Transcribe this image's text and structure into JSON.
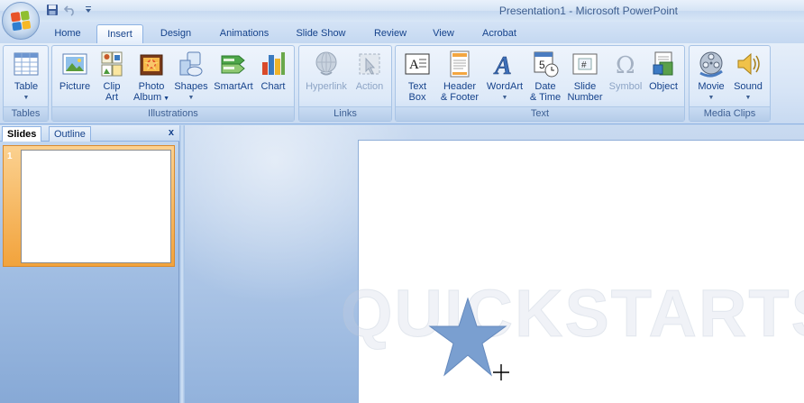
{
  "window": {
    "title": "Presentation1 - Microsoft PowerPoint"
  },
  "quick_access": {
    "save_icon": "save-icon",
    "undo_icon": "undo-icon",
    "customize_icon": "customize-qat-icon"
  },
  "tabs": [
    {
      "label": "Home"
    },
    {
      "label": "Insert"
    },
    {
      "label": "Design"
    },
    {
      "label": "Animations"
    },
    {
      "label": "Slide Show"
    },
    {
      "label": "Review"
    },
    {
      "label": "View"
    },
    {
      "label": "Acrobat"
    }
  ],
  "active_tab": "Insert",
  "ribbon": {
    "groups": {
      "tables": {
        "label": "Tables"
      },
      "illustrations": {
        "label": "Illustrations"
      },
      "links": {
        "label": "Links"
      },
      "text": {
        "label": "Text"
      },
      "media": {
        "label": "Media Clips"
      }
    },
    "commands": {
      "table": {
        "line1": "Table",
        "line2": ""
      },
      "picture": {
        "line1": "Picture",
        "line2": ""
      },
      "clipart": {
        "line1": "Clip",
        "line2": "Art"
      },
      "photoalbum": {
        "line1": "Photo",
        "line2": "Album"
      },
      "shapes": {
        "line1": "Shapes",
        "line2": ""
      },
      "smartart": {
        "line1": "SmartArt",
        "line2": ""
      },
      "chart": {
        "line1": "Chart",
        "line2": ""
      },
      "hyperlink": {
        "line1": "Hyperlink",
        "line2": ""
      },
      "action": {
        "line1": "Action",
        "line2": ""
      },
      "textbox": {
        "line1": "Text",
        "line2": "Box"
      },
      "headerfooter": {
        "line1": "Header",
        "line2": "& Footer"
      },
      "wordart": {
        "line1": "WordArt",
        "line2": ""
      },
      "datetime": {
        "line1": "Date",
        "line2": "& Time"
      },
      "slidenumber": {
        "line1": "Slide",
        "line2": "Number"
      },
      "symbol": {
        "line1": "Symbol",
        "line2": ""
      },
      "object": {
        "line1": "Object",
        "line2": ""
      },
      "movie": {
        "line1": "Movie",
        "line2": ""
      },
      "sound": {
        "line1": "Sound",
        "line2": ""
      }
    }
  },
  "left_pane": {
    "tab_slides": "Slides",
    "tab_outline": "Outline",
    "close_glyph": "x",
    "slide_number": "1"
  },
  "slide": {
    "watermark_text": "QUICKSTARTS",
    "shape": "star",
    "shape_color": "#7a9fd0"
  },
  "colors": {
    "ribbon_text": "#15428b",
    "thumb_highlight": "#f2a33c"
  }
}
